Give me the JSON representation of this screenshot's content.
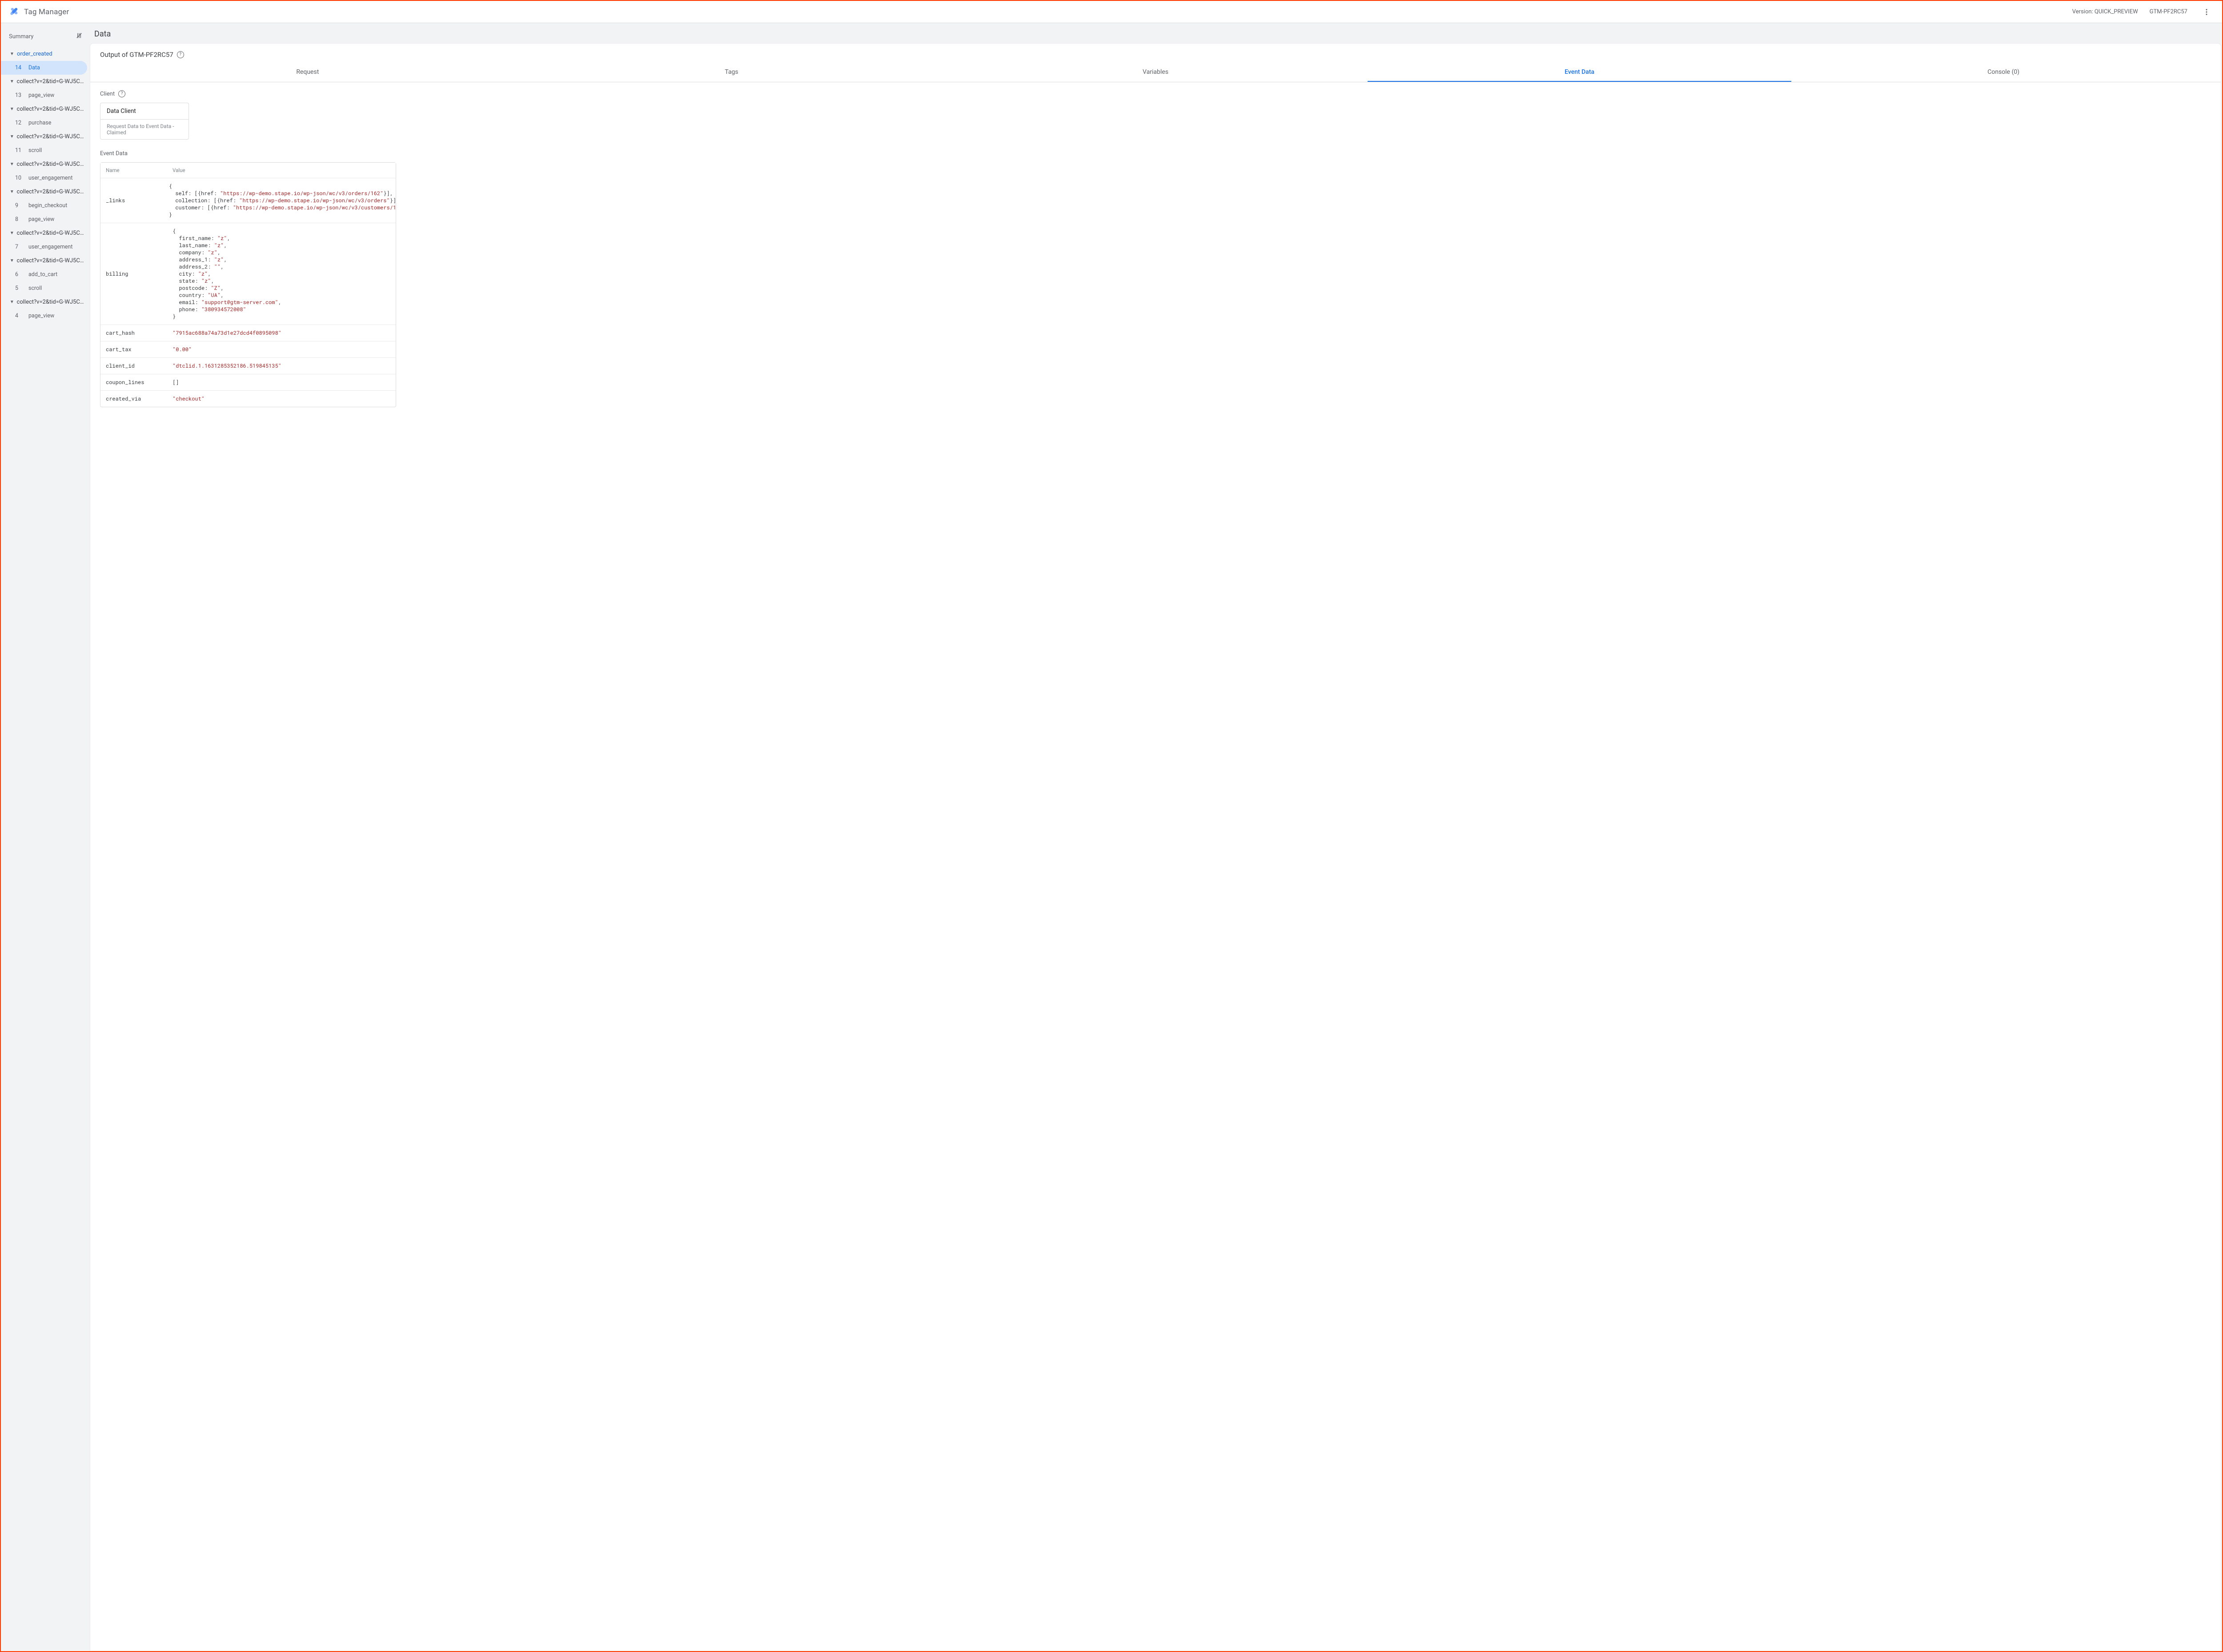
{
  "header": {
    "product_name": "Tag Manager",
    "version_label": "Version: QUICK_PREVIEW",
    "container_id": "GTM-PF2RC57"
  },
  "sidebar": {
    "summary_label": "Summary",
    "groups": [
      {
        "title": "order_created",
        "highlighted": true,
        "children": [
          {
            "num": "14",
            "label": "Data",
            "active": true
          }
        ]
      },
      {
        "title": "collect?v=2&tid=G-WJ5CL...",
        "children": [
          {
            "num": "13",
            "label": "page_view"
          }
        ]
      },
      {
        "title": "collect?v=2&tid=G-WJ5CL...",
        "children": [
          {
            "num": "12",
            "label": "purchase"
          }
        ]
      },
      {
        "title": "collect?v=2&tid=G-WJ5CL...",
        "children": [
          {
            "num": "11",
            "label": "scroll"
          }
        ]
      },
      {
        "title": "collect?v=2&tid=G-WJ5CL...",
        "children": [
          {
            "num": "10",
            "label": "user_engagement"
          }
        ]
      },
      {
        "title": "collect?v=2&tid=G-WJ5CL...",
        "children": [
          {
            "num": "9",
            "label": "begin_checkout"
          },
          {
            "num": "8",
            "label": "page_view"
          }
        ]
      },
      {
        "title": "collect?v=2&tid=G-WJ5CL...",
        "children": [
          {
            "num": "7",
            "label": "user_engagement"
          }
        ]
      },
      {
        "title": "collect?v=2&tid=G-WJ5CL...",
        "children": [
          {
            "num": "6",
            "label": "add_to_cart"
          },
          {
            "num": "5",
            "label": "scroll"
          }
        ]
      },
      {
        "title": "collect?v=2&tid=G-WJ5CL...",
        "children": [
          {
            "num": "4",
            "label": "page_view"
          }
        ]
      }
    ]
  },
  "main": {
    "page_title": "Data",
    "output_title": "Output of GTM-PF2RC57",
    "tabs": [
      "Request",
      "Tags",
      "Variables",
      "Event Data",
      "Console (0)"
    ],
    "active_tab_index": 3,
    "client_section_label": "Client",
    "client_box": {
      "name": "Data Client",
      "desc": "Request Data to Event Data - Claimed"
    },
    "event_section_label": "Event Data",
    "kv_headers": {
      "name": "Name",
      "value": "Value"
    },
    "event_data": {
      "_links": {
        "self": [
          {
            "href": "https://wp-demo.stape.io/wp-json/wc/v3/orders/162"
          }
        ],
        "collection": [
          {
            "href": "https://wp-demo.stape.io/wp-json/wc/v3/orders"
          }
        ],
        "customer": [
          {
            "href": "https://wp-demo.stape.io/wp-json/wc/v3/customers/1"
          }
        ]
      },
      "billing": {
        "first_name": "z",
        "last_name": "z",
        "company": "z",
        "address_1": "z",
        "address_2": "",
        "city": "z",
        "state": "z",
        "postcode": "Z",
        "country": "UA",
        "email": "support@gtm-server.com",
        "phone": "380934572008"
      },
      "cart_hash": "7915ac688a74a73d1e27dcd4f0895098",
      "cart_tax": "0.00",
      "client_id": "dtclid.1.1631285352186.519845135",
      "coupon_lines": [],
      "created_via": "checkout"
    }
  }
}
